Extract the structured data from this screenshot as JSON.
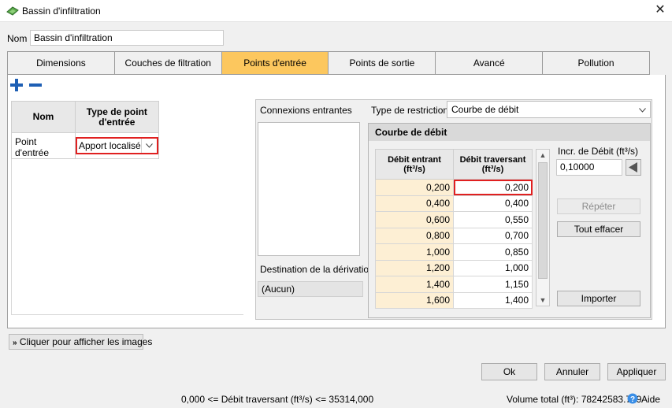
{
  "window": {
    "title": "Bassin d'infiltration",
    "close_glyph": "✕"
  },
  "name_field": {
    "label": "Nom",
    "value": "Bassin d'infiltration"
  },
  "tabs": [
    {
      "label": "Dimensions",
      "active": false
    },
    {
      "label": "Couches de filtration",
      "active": false
    },
    {
      "label": "Points d'entrée",
      "active": true
    },
    {
      "label": "Points de sortie",
      "active": false
    },
    {
      "label": "Avancé",
      "active": false
    },
    {
      "label": "Pollution",
      "active": false
    }
  ],
  "entry_points": {
    "headers": [
      "Nom",
      "Type de point d'entrée"
    ],
    "rows": [
      {
        "name": "Point d'entrée",
        "type": "Apport localisé"
      }
    ]
  },
  "connections": {
    "label": "Connexions entrantes",
    "restriction_label": "Type de restriction",
    "restriction_value": "Courbe de débit",
    "derivation_label": "Destination de la dérivation",
    "derivation_value": "(Aucun)"
  },
  "curve": {
    "title": "Courbe de débit",
    "col1": "Débit entrant (ft³/s)",
    "col2": "Débit traversant (ft³/s)",
    "rows": [
      [
        "0,200",
        "0,200"
      ],
      [
        "0,400",
        "0,400"
      ],
      [
        "0,600",
        "0,550"
      ],
      [
        "0,800",
        "0,700"
      ],
      [
        "1,000",
        "0,850"
      ],
      [
        "1,200",
        "1,000"
      ],
      [
        "1,400",
        "1,150"
      ],
      [
        "1,600",
        "1,400"
      ]
    ],
    "incr_label": "Incr. de Débit (ft³/s)",
    "incr_value": "0,10000",
    "repeat_label": "Répéter",
    "clear_label": "Tout effacer",
    "import_label": "Importer"
  },
  "images_button": "Cliquer pour afficher les images",
  "buttons": {
    "ok": "Ok",
    "cancel": "Annuler",
    "apply": "Appliquer"
  },
  "status": {
    "constraint": "0,000 <= Débit traversant (ft³/s) <= 35314,000",
    "volume": "Volume total (ft³): 78242583.789",
    "help": "Aide"
  },
  "colors": {
    "active_tab": "#fcc75e",
    "highlight_red": "#e02020",
    "input_col": "#fdefd4",
    "icon_blue": "#1e5fb4"
  }
}
